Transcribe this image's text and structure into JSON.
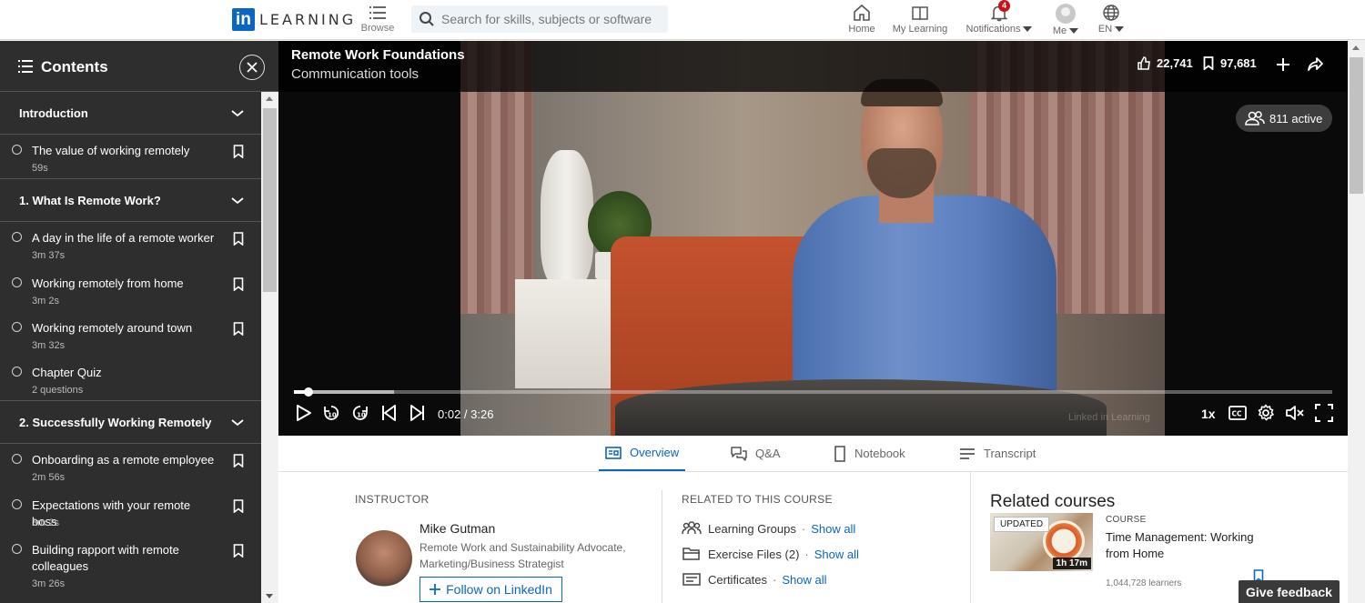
{
  "nav": {
    "brand": "LEARNING",
    "browse_label": "Browse",
    "search_placeholder": "Search for skills, subjects or software",
    "home_label": "Home",
    "mylearning_label": "My Learning",
    "notifications_label": "Notifications",
    "notifications_count": "4",
    "me_label": "Me",
    "lang_label": "EN"
  },
  "sidebar": {
    "title": "Contents",
    "sections": [
      {
        "title": "Introduction",
        "items": [
          {
            "title": "The value of working remotely",
            "duration": "59s"
          }
        ]
      },
      {
        "title": "1. What Is Remote Work?",
        "items": [
          {
            "title": "A day in the life of a remote worker",
            "duration": "3m 37s"
          },
          {
            "title": "Working remotely from home",
            "duration": "3m 2s"
          },
          {
            "title": "Working remotely around town",
            "duration": "3m 32s"
          },
          {
            "title": "Chapter Quiz",
            "duration": "2 questions"
          }
        ]
      },
      {
        "title": "2. Successfully Working Remotely",
        "items": [
          {
            "title": "Onboarding as a remote employee",
            "duration": "2m 56s"
          },
          {
            "title": "Expectations with your remote boss",
            "duration": "3m 2s"
          },
          {
            "title": "Building rapport with remote colleagues",
            "duration": "3m 26s"
          }
        ]
      }
    ]
  },
  "video": {
    "course_title": "Remote Work Foundations",
    "video_title": "Communication tools",
    "likes": "22,741",
    "saves": "97,681",
    "active": "811 active",
    "time": "0:02 / 3:26",
    "progress": 0.014,
    "speed": "1x",
    "watermark": "Linked in Learning"
  },
  "tabs": [
    {
      "label": "Overview",
      "active": true
    },
    {
      "label": "Q&A",
      "active": false
    },
    {
      "label": "Notebook",
      "active": false
    },
    {
      "label": "Transcript",
      "active": false
    }
  ],
  "instructor": {
    "heading": "INSTRUCTOR",
    "name": "Mike Gutman",
    "desc": "Remote Work and Sustainability Advocate, Marketing/Business Strategist",
    "follow_label": "Follow on LinkedIn"
  },
  "related": {
    "heading": "RELATED TO THIS COURSE",
    "rows": [
      {
        "label": "Learning Groups",
        "show": "Show all"
      },
      {
        "label": "Exercise Files (2)",
        "show": "Show all"
      },
      {
        "label": "Certificates",
        "show": "Show all"
      }
    ]
  },
  "related_courses": {
    "heading": "Related courses",
    "badge": "UPDATED",
    "duration": "1h 17m",
    "kind": "COURSE",
    "title": "Time Management: Working from Home",
    "learners": "1,044,728 learners"
  },
  "feedback_label": "Give feedback",
  "colors": {
    "accent": "#0a66c2",
    "sidebar_bg": "#2e2e2e",
    "badge": "#cc1016"
  }
}
